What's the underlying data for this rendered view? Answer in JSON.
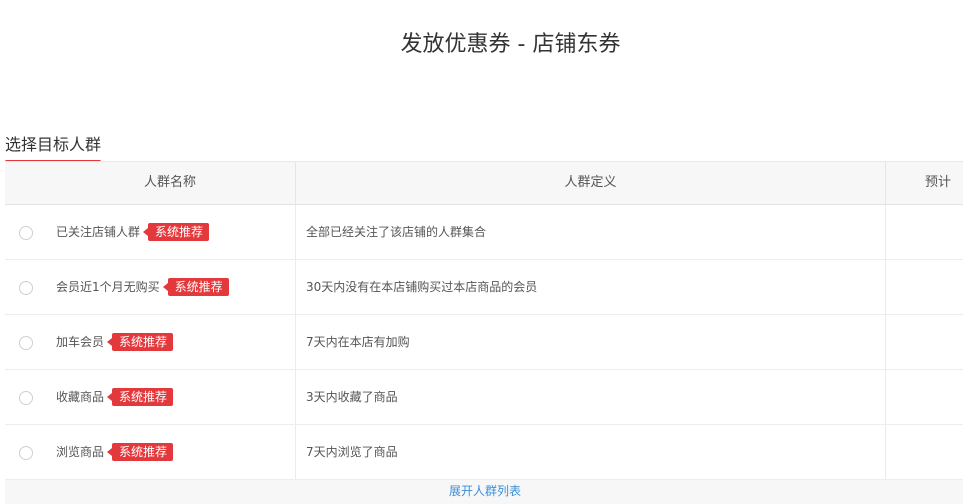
{
  "page": {
    "title": "发放优惠券 - 店铺东券"
  },
  "section": {
    "title": "选择目标人群"
  },
  "table": {
    "headers": [
      "人群名称",
      "人群定义",
      "预计"
    ],
    "rows": [
      {
        "name": "已关注店铺人群",
        "badge": "系统推荐",
        "definition": "全部已经关注了该店铺的人群集合"
      },
      {
        "name": "会员近1个月无购买",
        "badge": "系统推荐",
        "definition": "30天内没有在本店铺购买过本店商品的会员"
      },
      {
        "name": "加车会员",
        "badge": "系统推荐",
        "definition": "7天内在本店有加购"
      },
      {
        "name": "收藏商品",
        "badge": "系统推荐",
        "definition": "3天内收藏了商品"
      },
      {
        "name": "浏览商品",
        "badge": "系统推荐",
        "definition": "7天内浏览了商品"
      }
    ],
    "expand_label": "展开人群列表"
  },
  "colors": {
    "accent": "#e4393c",
    "link": "#3b8fd9"
  }
}
